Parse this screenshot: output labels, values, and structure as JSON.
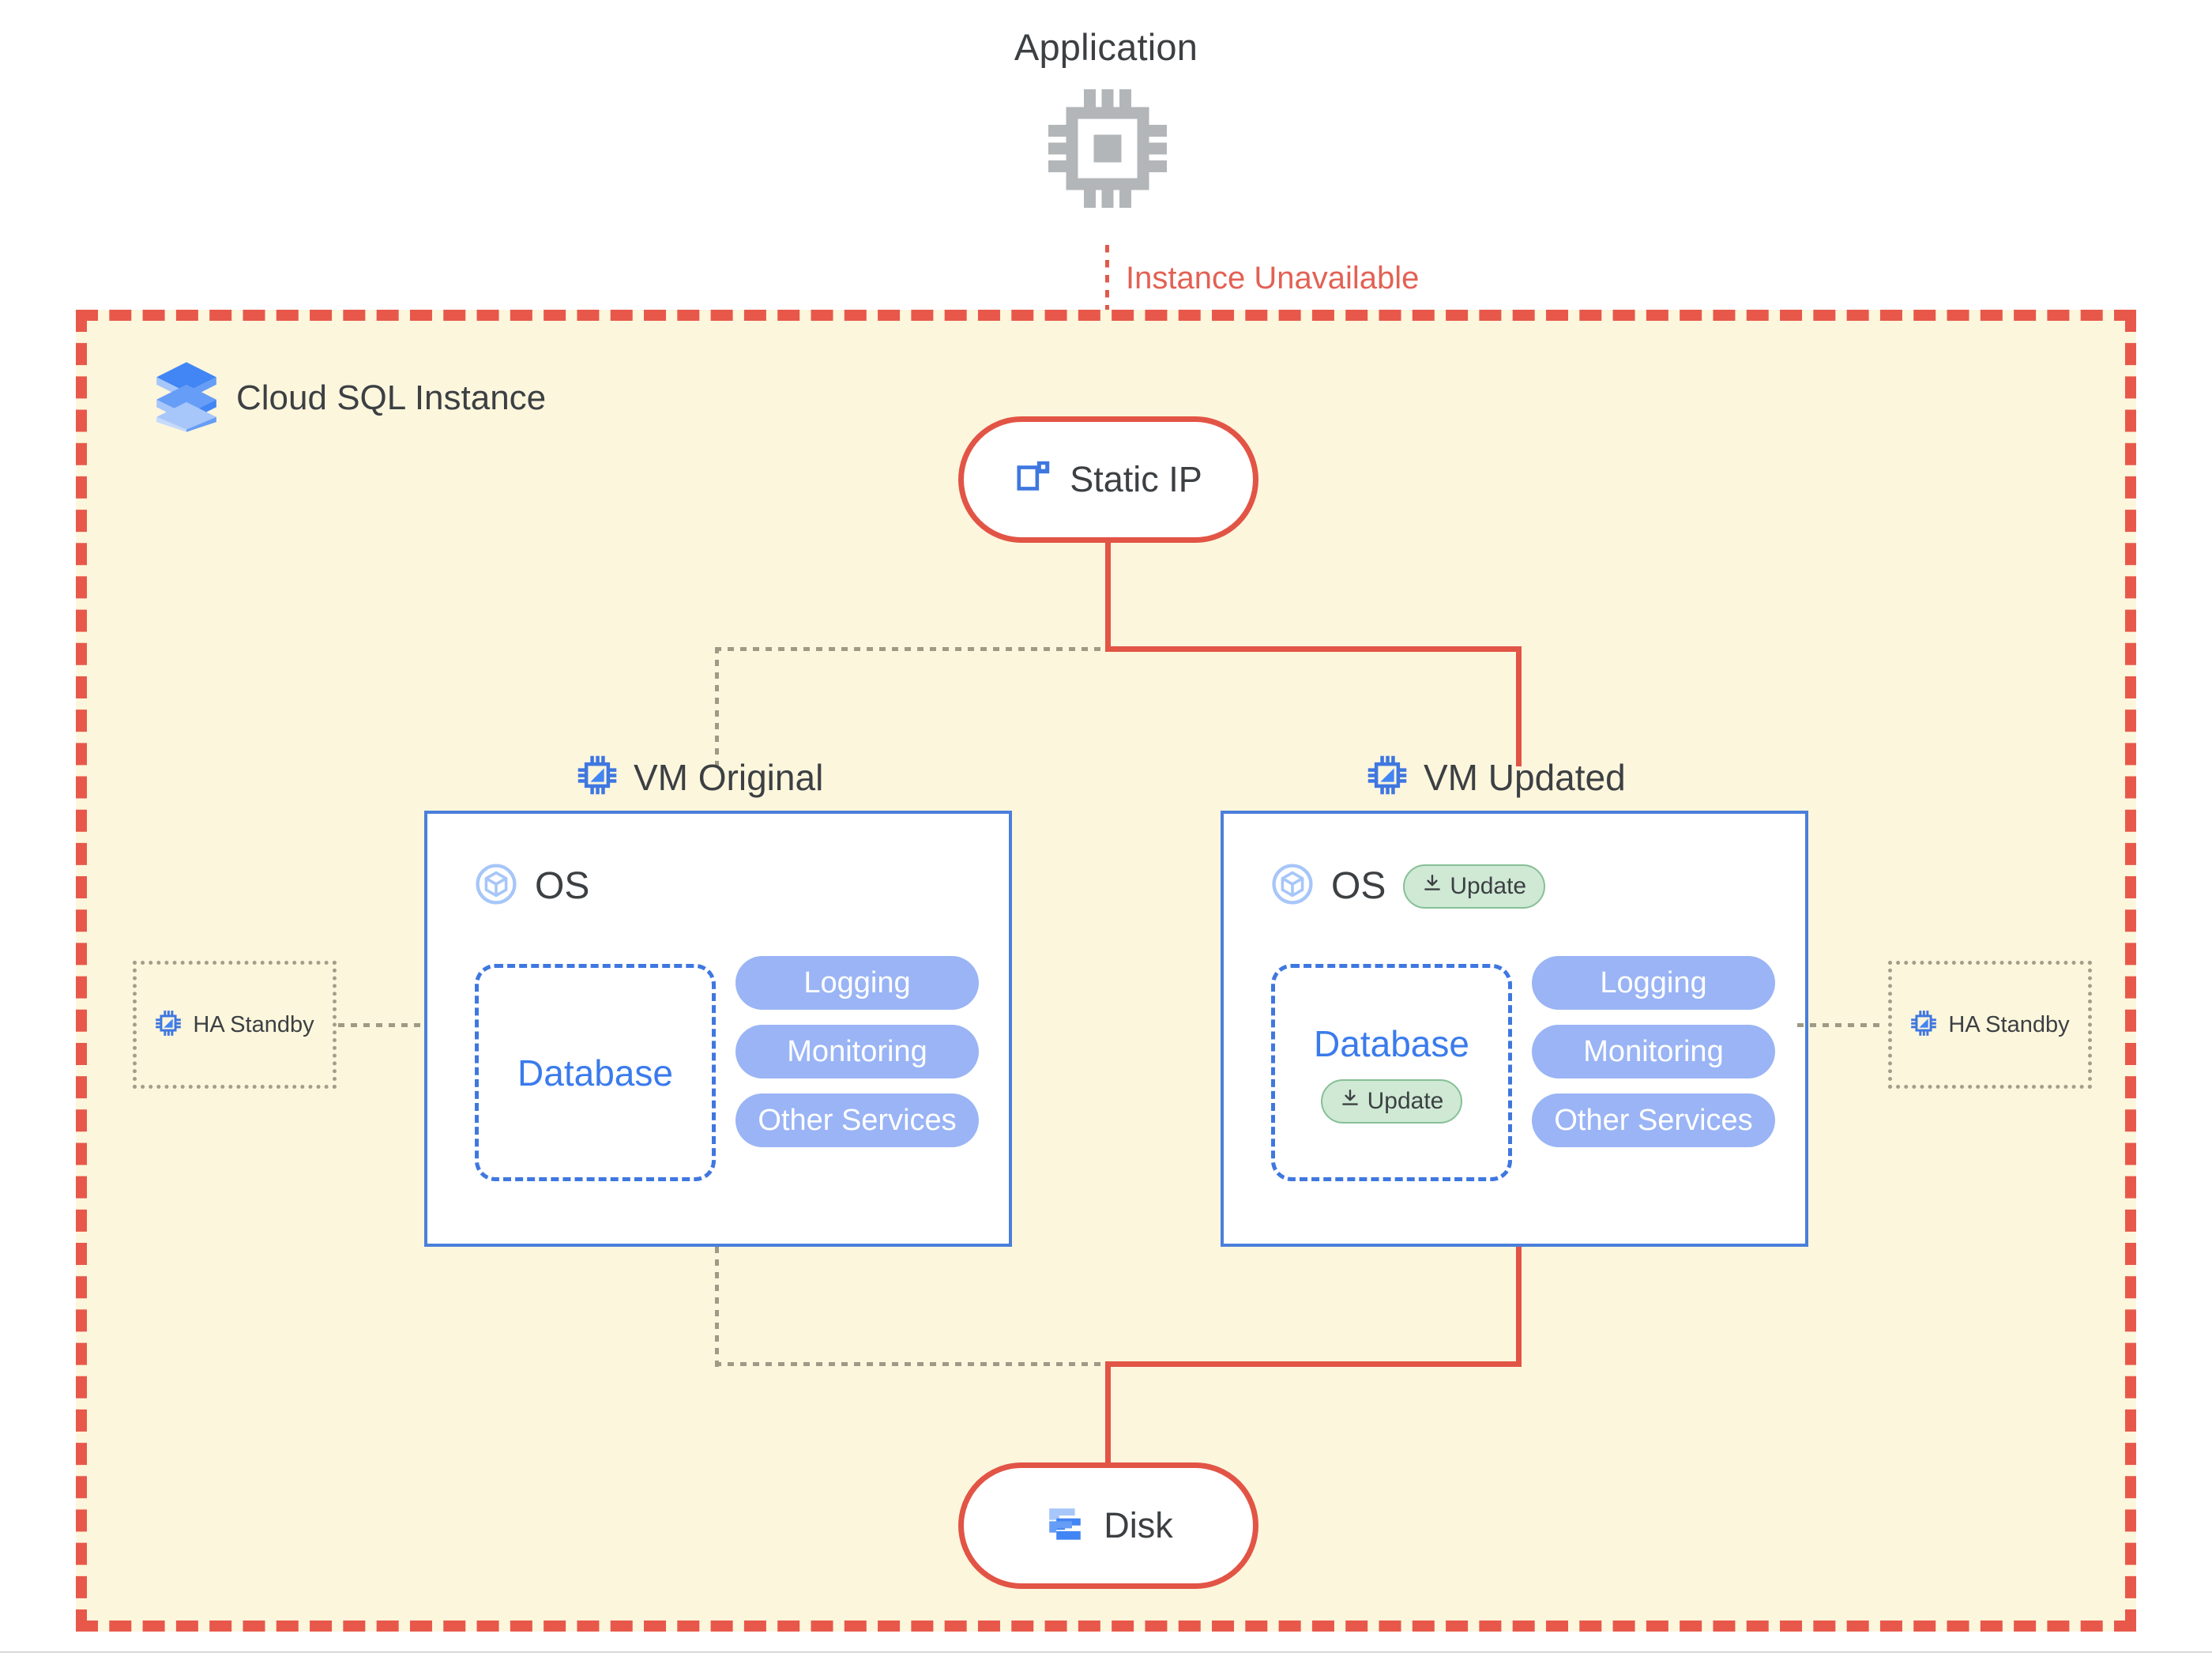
{
  "diagram": {
    "application": {
      "label": "Application",
      "icon": "cpu-chip-icon"
    },
    "connection_status": {
      "label": "Instance Unavailable",
      "color": "#e36154"
    },
    "container": {
      "label": "Cloud SQL Instance",
      "icon": "cloud-sql-stack-icon",
      "border_color": "#e8584a",
      "background_color": "#fcf6dd"
    },
    "static_ip": {
      "label": "Static IP",
      "icon": "static-ip-icon",
      "border_color": "#e25445"
    },
    "disk": {
      "label": "Disk",
      "icon": "persistent-disk-icon",
      "border_color": "#e25445"
    },
    "vms": [
      {
        "title": "VM Original",
        "icon": "vm-chip-icon",
        "os": {
          "label": "OS",
          "icon": "os-cube-icon",
          "update_badge": null
        },
        "database": {
          "label": "Database",
          "update_badge": null
        },
        "services": [
          "Logging",
          "Monitoring",
          "Other Services"
        ],
        "ha_standby": {
          "label": "HA Standby",
          "icon": "vm-chip-icon"
        }
      },
      {
        "title": "VM Updated",
        "icon": "vm-chip-icon",
        "os": {
          "label": "OS",
          "icon": "os-cube-icon",
          "update_badge": "Update"
        },
        "database": {
          "label": "Database",
          "update_badge": "Update"
        },
        "services": [
          "Logging",
          "Monitoring",
          "Other Services"
        ],
        "ha_standby": {
          "label": "HA Standby",
          "icon": "vm-chip-icon"
        }
      }
    ],
    "badge_icon": "download-icon",
    "colors": {
      "accent_red": "#e25445",
      "service_pill_blue": "#9ab4f5",
      "database_blue": "#3a7bec",
      "vm_border_blue": "#4a7fdb",
      "update_green_fill": "#cfe9d4",
      "update_green_border": "#86c096",
      "dotted_gray": "#9e9a86"
    }
  }
}
